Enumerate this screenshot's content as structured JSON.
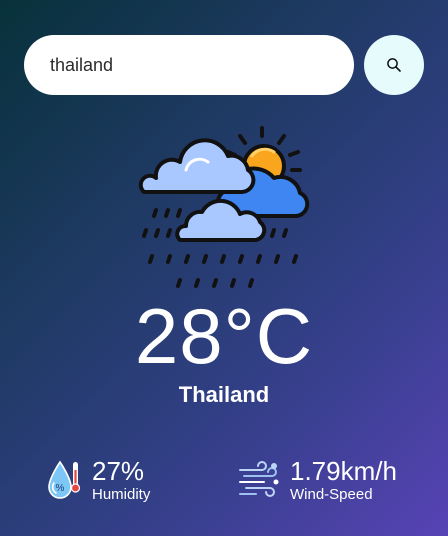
{
  "search": {
    "value": "thailand",
    "placeholder": "",
    "button_icon": "search-icon"
  },
  "weather": {
    "icon": "cloud-sun-rain-icon",
    "temperature": "28°C",
    "city": "Thailand"
  },
  "details": {
    "humidity": {
      "icon": "humidity-icon",
      "value": "27%",
      "label": "Humidity"
    },
    "wind": {
      "icon": "wind-icon",
      "value": "1.79km/h",
      "label": "Wind-Speed"
    }
  },
  "colors": {
    "background_start": "#07313a",
    "background_end": "#5743b5",
    "search_button_bg": "#e6fbfb",
    "sun": "#f9a51d",
    "cloud_back": "#3f86f2",
    "cloud_front": "#a9c8ff"
  }
}
